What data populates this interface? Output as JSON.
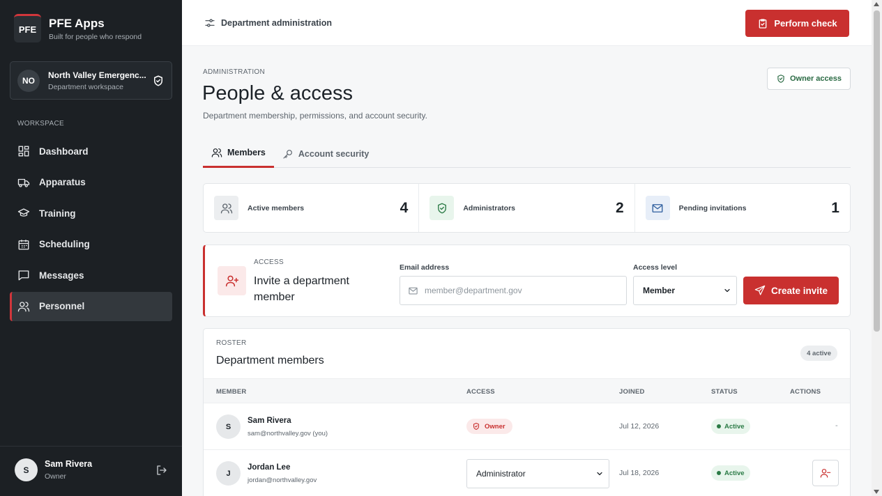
{
  "app": {
    "logo": "PFE",
    "name": "PFE Apps",
    "tagline": "Built for people who respond"
  },
  "workspace": {
    "initials": "NO",
    "name": "North Valley Emergenc...",
    "sub": "Department workspace",
    "icon": "shield-check-icon"
  },
  "sidebar": {
    "section_label": "WORKSPACE",
    "items": [
      {
        "label": "Dashboard",
        "icon": "dashboard-icon"
      },
      {
        "label": "Apparatus",
        "icon": "truck-icon"
      },
      {
        "label": "Training",
        "icon": "graduation-cap-icon"
      },
      {
        "label": "Scheduling",
        "icon": "calendar-icon"
      },
      {
        "label": "Messages",
        "icon": "message-icon"
      },
      {
        "label": "Personnel",
        "icon": "users-icon",
        "active": true
      }
    ]
  },
  "user": {
    "initial": "S",
    "name": "Sam Rivera",
    "role": "Owner"
  },
  "topbar": {
    "title": "Department administration",
    "button": "Perform check"
  },
  "page": {
    "eyebrow": "ADMINISTRATION",
    "title": "People & access",
    "subtitle": "Department membership, permissions, and account security.",
    "owner_access": "Owner access"
  },
  "tabs": [
    {
      "label": "Members",
      "active": true
    },
    {
      "label": "Account security"
    }
  ],
  "stats": [
    {
      "label": "Active members",
      "value": "4"
    },
    {
      "label": "Administrators",
      "value": "2"
    },
    {
      "label": "Pending invitations",
      "value": "1"
    }
  ],
  "invite": {
    "eyebrow": "ACCESS",
    "title": "Invite a department member",
    "email_label": "Email address",
    "email_placeholder": "member@department.gov",
    "access_label": "Access level",
    "access_value": "Member",
    "button": "Create invite"
  },
  "roster": {
    "eyebrow": "ROSTER",
    "title": "Department members",
    "badge": "4 active",
    "columns": [
      "MEMBER",
      "ACCESS",
      "JOINED",
      "STATUS",
      "ACTIONS"
    ],
    "rows": [
      {
        "initial": "S",
        "name": "Sam Rivera",
        "email": "sam@northvalley.gov (you)",
        "access": "Owner",
        "joined": "Jul 12, 2026",
        "status": "Active",
        "action": "-"
      },
      {
        "initial": "J",
        "name": "Jordan Lee",
        "email": "jordan@northvalley.gov",
        "access": "Administrator",
        "joined": "Jul 18, 2026",
        "status": "Active"
      }
    ]
  },
  "colors": {
    "accent": "#c9302f",
    "sidebar": "#1c2024",
    "success": "#2a7a45"
  }
}
